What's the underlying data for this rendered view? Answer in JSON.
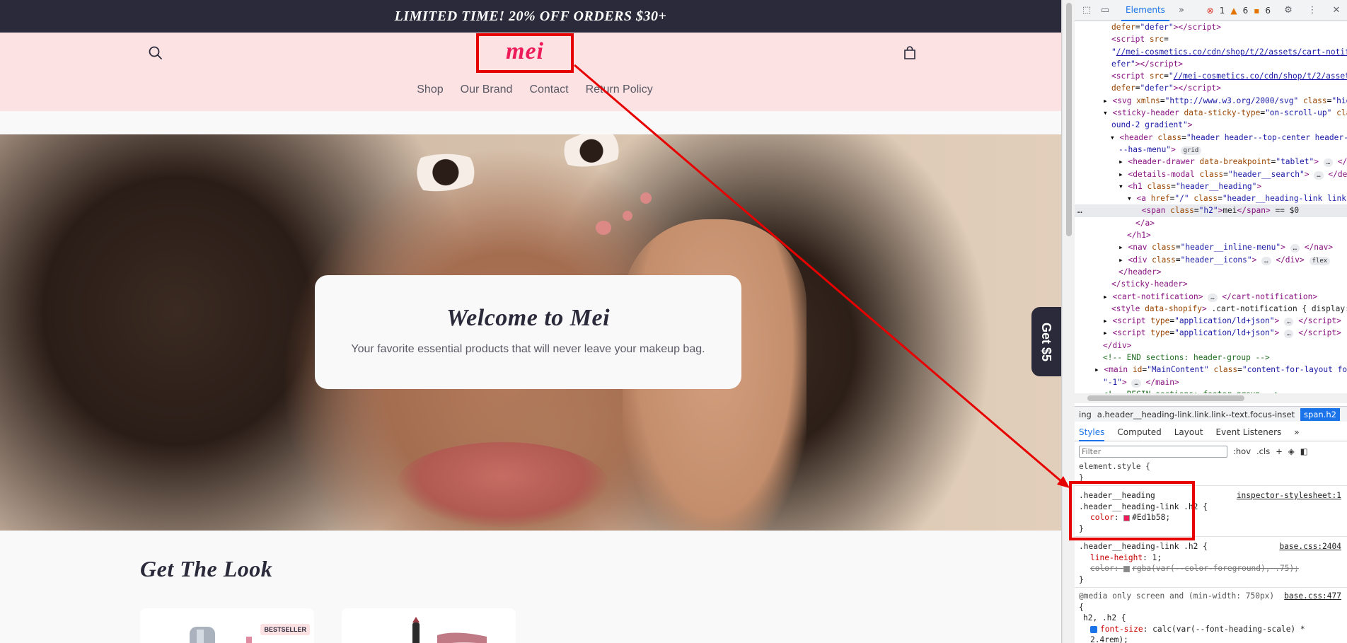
{
  "site": {
    "announcement": "LIMITED TIME! 20% OFF ORDERS $30+",
    "logo": "mei",
    "nav": [
      "Shop",
      "Our Brand",
      "Contact",
      "Return Policy"
    ],
    "hero": {
      "title": "Welcome to Mei",
      "subtitle": "Your favorite essential products that will never leave your makeup bag."
    },
    "get5_label": "Get $5",
    "section_title": "Get The Look",
    "product_badge": "BESTSELLER"
  },
  "devtools": {
    "tab": "Elements",
    "counts": {
      "errors": "1",
      "warnings": "6",
      "issues": "6"
    },
    "breadcrumb": [
      "ing",
      "a.header__heading-link.link.link--text.focus-inset",
      "span.h2"
    ],
    "style_tabs": [
      "Styles",
      "Computed",
      "Layout",
      "Event Listeners"
    ],
    "filter_placeholder": "Filter",
    "filter_tools": [
      ":hov",
      ".cls"
    ],
    "rules": {
      "element_style": "element.style {",
      "rule1_selector_a": ".header__heading",
      "rule1_selector_b": ".header__heading-link .h2 {",
      "rule1_source": "inspector-stylesheet:1",
      "rule1_prop": "color",
      "rule1_value": "#Ed1b58;",
      "rule2_selector": ".header__heading-link .h2 {",
      "rule2_source": "base.css:2404",
      "rule2_prop1": "line-height",
      "rule2_val1": "1;",
      "rule2_prop2": "color",
      "rule2_val2": "rgba(var(--color-foreground), .75);",
      "media": "@media only screen and (min-width: 750px)",
      "media_source": "base.css:477",
      "rule3_selector": "h2, .h2 {",
      "rule3_prop": "font-size",
      "rule3_val": "calc(var(--font-heading-scale) * 2.4rem);"
    },
    "colors": {
      "accent": "#ed1b58",
      "annotation": "#e60000",
      "header_bg": "#fde2e3",
      "dark": "#2b2a3b"
    }
  }
}
